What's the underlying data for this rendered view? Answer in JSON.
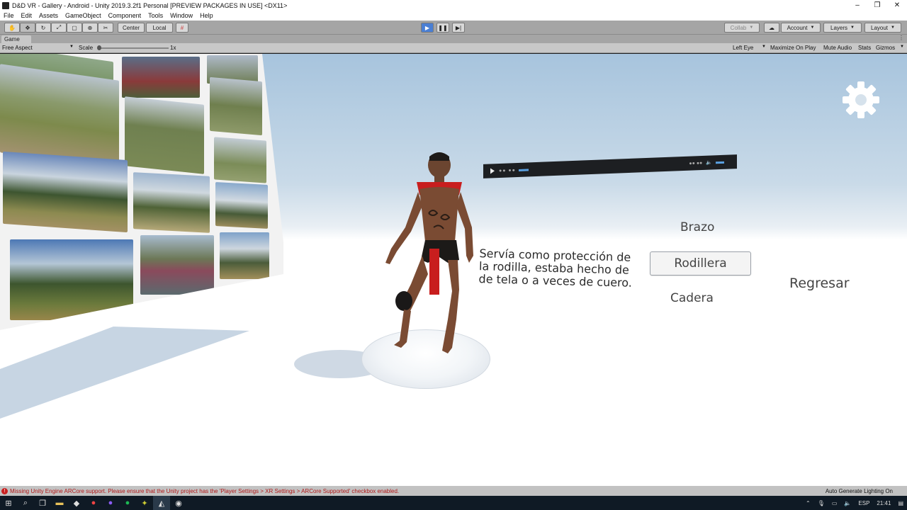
{
  "window": {
    "title": "D&D VR - Gallery - Android - Unity 2019.3.2f1 Personal [PREVIEW PACKAGES IN USE] <DX11>",
    "controls": [
      "–",
      "❐",
      "✕"
    ]
  },
  "menu": [
    "File",
    "Edit",
    "Assets",
    "GameObject",
    "Component",
    "Tools",
    "Window",
    "Help"
  ],
  "toolbar": {
    "pivot_label": "Center",
    "space_label": "Local",
    "collab_label": "Collab",
    "account_label": "Account",
    "layers_label": "Layers",
    "layout_label": "Layout"
  },
  "game_tab": {
    "title": "Game",
    "aspect": "Free Aspect",
    "scale_label": "Scale",
    "scale_value": "1x",
    "eye": "Left Eye",
    "maximize": "Maximize On Play",
    "mute": "Mute Audio",
    "stats": "Stats",
    "gizmos": "Gizmos"
  },
  "scene": {
    "description": "Servía como protección de la rodilla, estaba hecho de de tela o a veces de cuero.",
    "options": {
      "brazo": "Brazo",
      "rodillera": "Rodillera",
      "cadera": "Cadera"
    },
    "back": "Regresar",
    "colors": {
      "sky": "#a7c4dd",
      "floor": "#ffffff",
      "cape": "#c81e1e",
      "video_bar": "#1d1f22",
      "progress": "#5aa0e0"
    }
  },
  "status": {
    "error": "Missing Unity Engine ARCore support. Please ensure that the Unity project has the 'Player Settings > XR Settings > ARCore Supported' checkbox enabled.",
    "right": "Auto Generate Lighting On"
  },
  "taskbar": {
    "lang": "ESP",
    "time": "21:41"
  }
}
